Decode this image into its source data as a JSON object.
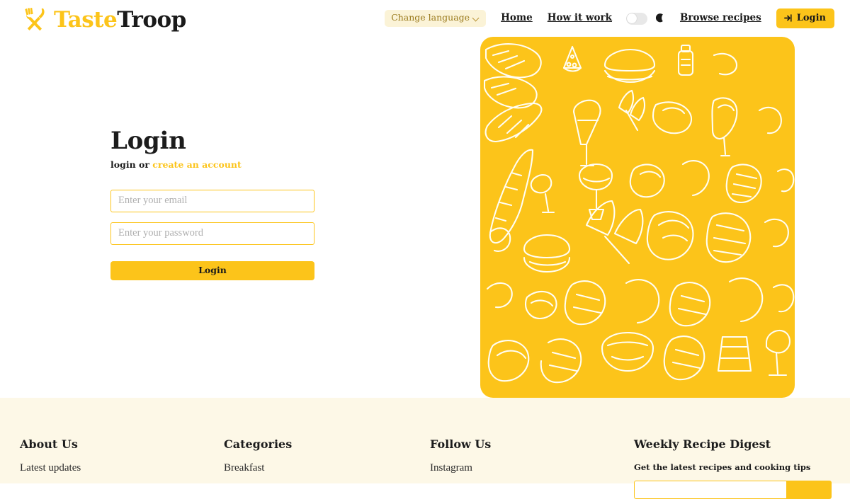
{
  "brand": {
    "name_part1": "Taste",
    "name_part2": "Troop",
    "icon": "fork-knife-icon",
    "color_primary": "#FCC41A",
    "color_dark": "#1a1a1a"
  },
  "nav": {
    "language_label": "Change language",
    "language_chevron": "chevron-down-icon",
    "links": [
      {
        "label": "Home"
      },
      {
        "label": "How it work"
      },
      {
        "label": "Browse recipes"
      }
    ],
    "theme_toggle": {
      "state": "off",
      "icon": "moon-icon"
    },
    "login_button": {
      "label": "Login",
      "icon": "sign-in-icon"
    }
  },
  "login": {
    "title": "Login",
    "subtitle_prefix": "login or ",
    "subtitle_link": "create an account",
    "email_placeholder": "Enter your email",
    "email_value": "",
    "password_placeholder": "Enter your password",
    "password_value": "",
    "submit_label": "Login"
  },
  "hero": {
    "alt": "food-doodle-pattern",
    "background": "#FCC41A",
    "line_color": "#FFFDF2"
  },
  "footer": {
    "background": "#FDF8E7",
    "columns": [
      {
        "heading": "About Us",
        "links": [
          {
            "label": "Latest updates"
          }
        ]
      },
      {
        "heading": "Categories",
        "links": [
          {
            "label": "Breakfast"
          }
        ]
      },
      {
        "heading": "Follow Us",
        "links": [
          {
            "label": "Instagram"
          }
        ]
      }
    ],
    "newsletter": {
      "heading": "Weekly Recipe Digest",
      "note": "Get the latest recipes and cooking tips",
      "input_placeholder": "",
      "input_value": "",
      "button_label": ""
    }
  }
}
